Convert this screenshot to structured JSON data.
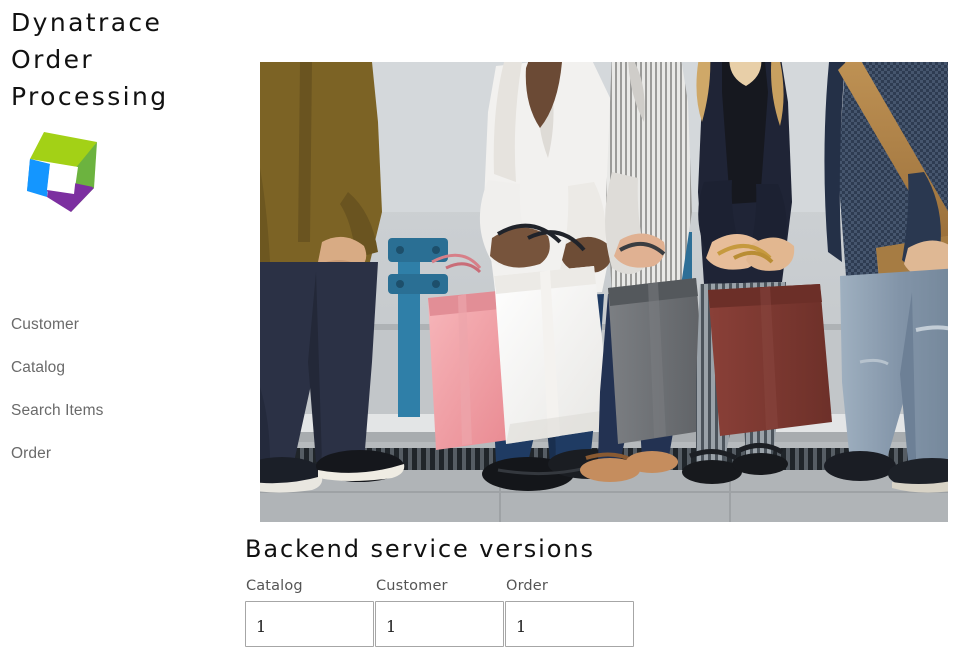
{
  "app": {
    "title_lines": [
      "Dynatrace",
      "Order",
      "Processing"
    ],
    "logo_name": "dynatrace-hexagon-logo",
    "logo_colors": {
      "top": "#a3d116",
      "right": "#6cb33f",
      "left": "#1496ff",
      "bottom": "#7c2fa0",
      "center": "#ffffff"
    }
  },
  "sidebar": {
    "items": [
      {
        "label": "Customer",
        "name": "sidebar-item-customer"
      },
      {
        "label": "Catalog",
        "name": "sidebar-item-catalog"
      },
      {
        "label": "Search Items",
        "name": "sidebar-item-search-items"
      },
      {
        "label": "Order",
        "name": "sidebar-item-order"
      }
    ]
  },
  "hero": {
    "alt": "Group of five shoppers standing against a wall holding paper shopping bags",
    "palette": {
      "wall": "#c9cdd0",
      "floor": "#b9bcbf",
      "grate": "#2c3136",
      "mustard_shirt": "#7c6325",
      "navy_trousers": "#2b3145",
      "white_blouse": "#f2f1ef",
      "pink_bag": "#f2a2a8",
      "white_bag": "#fbfbfa",
      "grey_bag": "#6f7276",
      "maroon_bag": "#7c3b35",
      "tan_satchel": "#b08347",
      "denim_shirt": "#2e3c52",
      "light_jeans": "#8ea2b4",
      "striped_trousers": "#8b939b",
      "blue_bracket": "#2f7fa8"
    }
  },
  "versions": {
    "heading": "Backend service versions",
    "fields": [
      {
        "label": "Catalog",
        "value": "1",
        "name": "catalog-version-input"
      },
      {
        "label": "Customer",
        "value": "1",
        "name": "customer-version-input"
      },
      {
        "label": "Order",
        "value": "1",
        "name": "order-version-input"
      }
    ]
  }
}
